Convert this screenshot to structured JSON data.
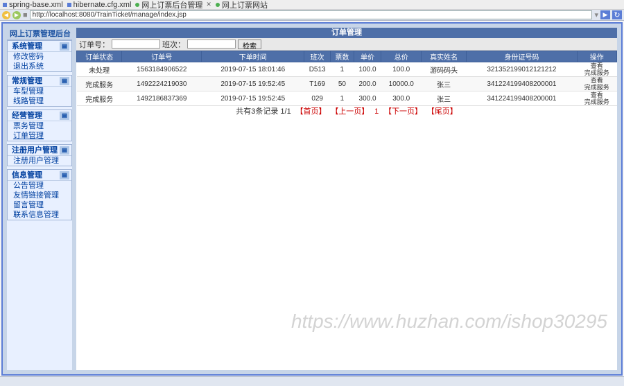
{
  "editor_tabs": [
    "spring-base.xml",
    "hibernate.cfg.xml",
    "网上订票后台管理",
    "网上订票网站"
  ],
  "address": {
    "url": "http://localhost:8080/TrainTicket/manage/index.jsp"
  },
  "sidebar": {
    "title": "网上订票管理后台",
    "sections": [
      {
        "head": "系统管理",
        "items": [
          "修改密码",
          "退出系统"
        ]
      },
      {
        "head": "常规管理",
        "items": [
          "车型管理",
          "线路管理"
        ]
      },
      {
        "head": "经营管理",
        "items": [
          "票务管理",
          "订单管理"
        ],
        "active_index": 1
      },
      {
        "head": "注册用户管理",
        "items": [
          "注册用户管理"
        ]
      },
      {
        "head": "信息管理",
        "items": [
          "公告管理",
          "友情链接管理",
          "留言管理",
          "联系信息管理"
        ]
      }
    ]
  },
  "page": {
    "title": "订单管理",
    "search": {
      "label1": "订单号：",
      "label2": "班次：",
      "btn": "检索"
    },
    "columns": [
      "订单状态",
      "订单号",
      "下单时间",
      "班次",
      "票数",
      "单价",
      "总价",
      "真实姓名",
      "身份证号码",
      "操作"
    ],
    "rows": [
      {
        "status": "未处理",
        "orderno": "1563184906522",
        "time": "2019-07-15 18:01:46",
        "train": "D513",
        "qty": "1",
        "price": "100.0",
        "total": "100.0",
        "name": "游码码头",
        "idcard": "321352199012121212",
        "ops": [
          "查看",
          "完成服务"
        ]
      },
      {
        "status": "完成服务",
        "orderno": "1492224219030",
        "time": "2019-07-15 19:52:45",
        "train": "T169",
        "qty": "50",
        "price": "200.0",
        "total": "10000.0",
        "name": "张三",
        "idcard": "341224199408200001",
        "ops": [
          "查看",
          "完成服务"
        ]
      },
      {
        "status": "完成服务",
        "orderno": "1492186837369",
        "time": "2019-07-15 19:52:45",
        "train": "029",
        "qty": "1",
        "price": "300.0",
        "total": "300.0",
        "name": "张三",
        "idcard": "341224199408200001",
        "ops": [
          "查看",
          "完成服务"
        ]
      }
    ],
    "pager": {
      "text": "共有3条记录 1/1",
      "first": "【首页】",
      "prev": "【上一页】",
      "current": "1",
      "next": "【下一页】",
      "last": "【尾页】"
    }
  },
  "watermark": "https://www.huzhan.com/ishop30295"
}
